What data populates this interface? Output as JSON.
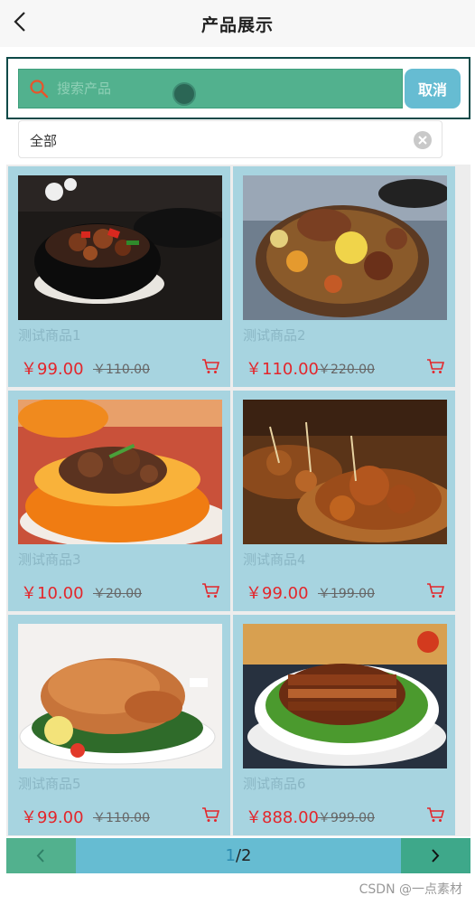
{
  "header": {
    "title": "产品展示",
    "back_icon": "chevron-left-icon"
  },
  "search": {
    "placeholder": "搜索产品",
    "value": "",
    "cancel_label": "取消",
    "icon": "search-icon"
  },
  "filter": {
    "value": "全部",
    "clear_icon": "close-circle-icon"
  },
  "products": [
    {
      "name": "测试商品1",
      "price": "￥99.00",
      "old_price": "￥110.00",
      "image": "braised-ribs-clay-pot"
    },
    {
      "name": "测试商品2",
      "price": "￥110.00",
      "old_price": "￥220.00",
      "image": "braised-duck-potato"
    },
    {
      "name": "测试商品3",
      "price": "￥10.00",
      "old_price": "￥20.00",
      "image": "ribs-in-pumpkin"
    },
    {
      "name": "测试商品4",
      "price": "￥99.00",
      "old_price": "￥199.00",
      "image": "grilled-skewers"
    },
    {
      "name": "测试商品5",
      "price": "￥99.00",
      "old_price": "￥110.00",
      "image": "roast-chicken"
    },
    {
      "name": "测试商品6",
      "price": "￥888.00",
      "old_price": "￥999.00",
      "image": "braised-pork-belly"
    }
  ],
  "pagination": {
    "current": "1",
    "separator": "/",
    "total": "2",
    "prev_icon": "chevron-left-icon",
    "next_icon": "chevron-right-icon"
  },
  "watermark": "CSDN @一点素材",
  "colors": {
    "accent_green": "#52b18e",
    "accent_blue": "#66bcd2",
    "card_bg": "#a7d4e0",
    "price_red": "#e3262b"
  }
}
